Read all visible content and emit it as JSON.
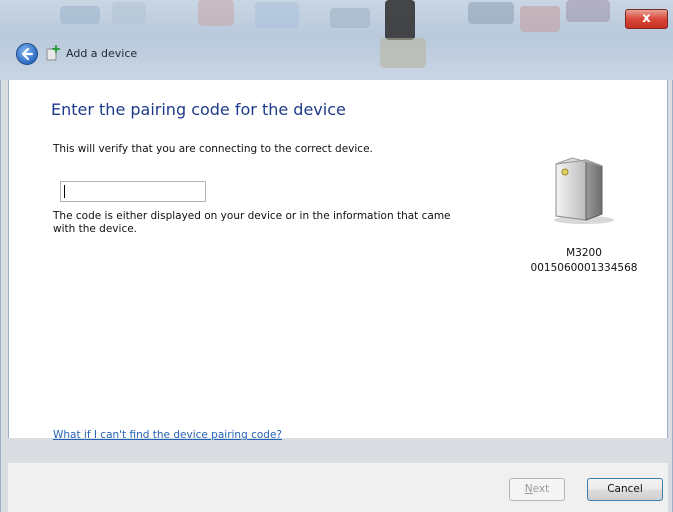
{
  "window": {
    "title": "Add a device",
    "close_glyph": "x"
  },
  "content": {
    "heading": "Enter the pairing code for the device",
    "verify_text": "This will verify that you are connecting to the correct device.",
    "code_input_value": "",
    "hint_text": "The code is either displayed on your device or in the information that came with the device.",
    "device": {
      "name": "M3200",
      "address": "0015060001334568",
      "icon": "printer-device-icon"
    },
    "help_link": "What if I can't find the device pairing code?"
  },
  "footer": {
    "next_label_underlined": "N",
    "next_label_rest": "ext",
    "next_enabled": false,
    "cancel_label": "Cancel"
  },
  "colors": {
    "heading": "#1e3a8a",
    "link": "#2563b8",
    "close_button": "#d9483a"
  }
}
